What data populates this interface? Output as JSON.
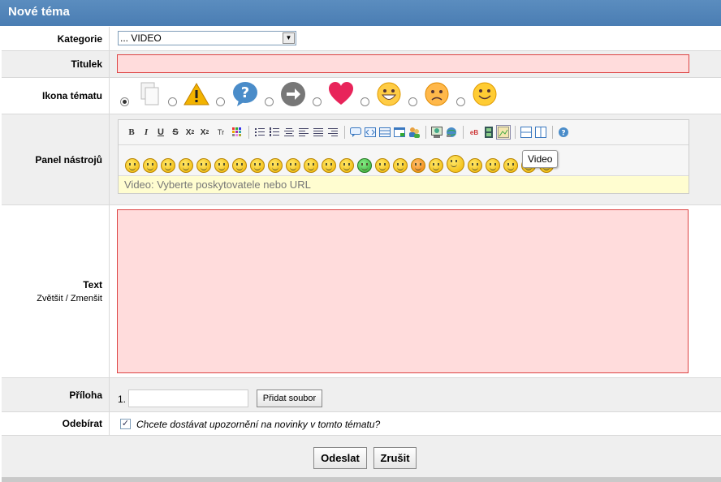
{
  "page": {
    "title": "Nové téma"
  },
  "kategorie": {
    "label": "Kategorie",
    "value": "... VIDEO"
  },
  "titulek": {
    "label": "Titulek",
    "value": ""
  },
  "ikona": {
    "label": "Ikona tématu",
    "icons": [
      "document-icon",
      "warning-icon",
      "question-icon",
      "arrow-right-icon",
      "heart-icon",
      "happy-face-icon",
      "sad-face-icon",
      "smile-face-icon"
    ],
    "selected_index": 0
  },
  "panel": {
    "label": "Panel nástrojů",
    "tooltip": "Video",
    "video_hint": "Video: Vyberte poskytovatele nebo URL",
    "format_buttons": [
      "B",
      "I",
      "U",
      "S",
      "X2",
      "X2",
      "Tr"
    ]
  },
  "text": {
    "label": "Text",
    "zoom_in": "Zvětšit",
    "separator": "/",
    "zoom_out": "Zmenšit"
  },
  "priloha": {
    "label": "Příloha",
    "index": "1.",
    "add_button": "Přidat soubor"
  },
  "odebirat": {
    "label": "Odebírat",
    "checked": true,
    "text": "Chcete dostávat upozornění na novinky v tomto tématu?"
  },
  "actions": {
    "submit": "Odeslat",
    "cancel": "Zrušit"
  },
  "colors": {
    "header": "#4f85b8",
    "pink": "#ffdcdc",
    "yellow_bar": "#fffdd0"
  }
}
